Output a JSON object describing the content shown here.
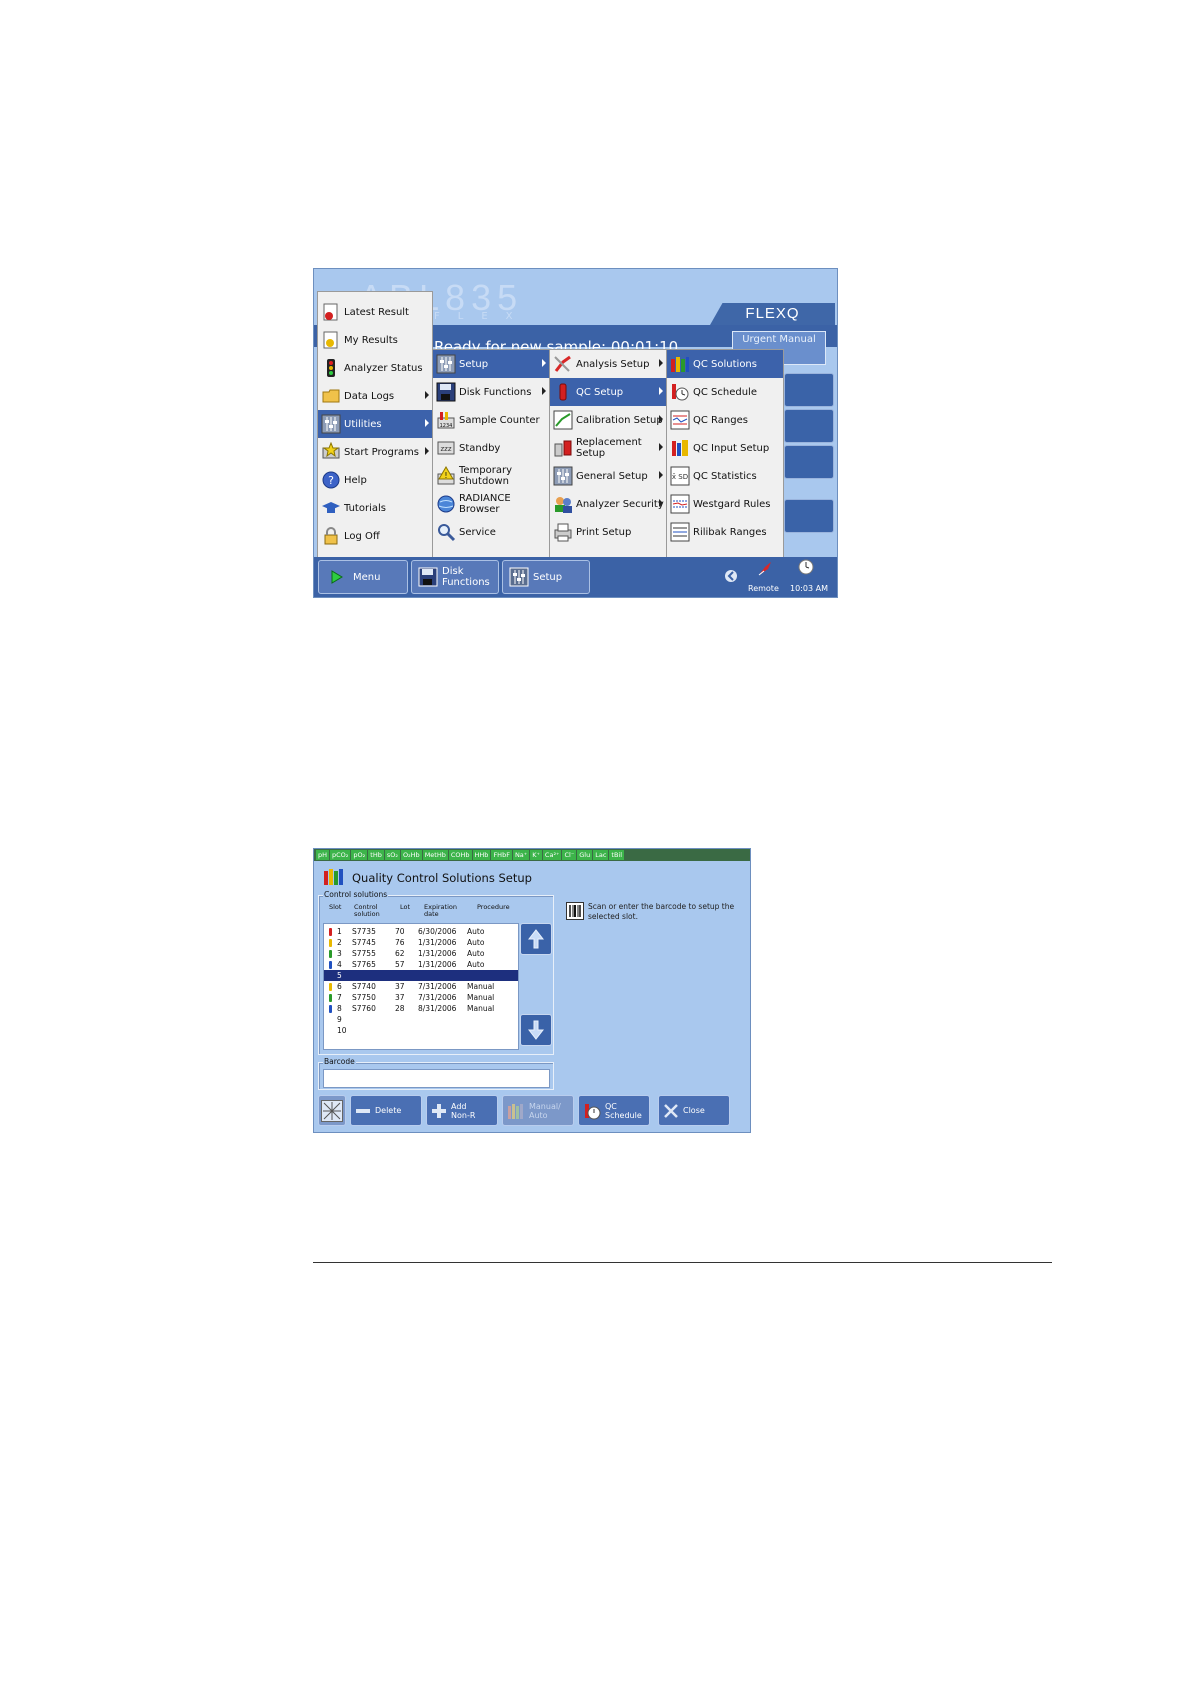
{
  "menu_screen": {
    "logo": "ABL835",
    "logo_sub": "FLEX",
    "model_badge": "FLEXQ",
    "status_text": "Ready for new sample: 00:01:10",
    "urgent_button": "Urgent Manual",
    "main_menu": [
      {
        "label": "Latest Result",
        "icon": "latest-result-icon"
      },
      {
        "label": "My Results",
        "icon": "my-results-icon"
      },
      {
        "label": "Analyzer Status",
        "icon": "traffic-light-icon"
      },
      {
        "label": "Data Logs",
        "icon": "folder-icon"
      },
      {
        "label": "Utilities",
        "icon": "sliders-icon"
      },
      {
        "label": "Start Programs",
        "icon": "star-programs-icon"
      },
      {
        "label": "Help",
        "icon": "help-icon"
      },
      {
        "label": "Tutorials",
        "icon": "tutorials-icon"
      },
      {
        "label": "Log Off",
        "icon": "lock-icon"
      }
    ],
    "utilities_menu": [
      {
        "label": "Setup",
        "icon": "sliders-icon"
      },
      {
        "label": "Disk Functions",
        "icon": "disk-icon"
      },
      {
        "label": "Sample Counter",
        "icon": "counter-icon"
      },
      {
        "label": "Standby",
        "icon": "standby-icon"
      },
      {
        "label": "Temporary\nShutdown",
        "icon": "warning-icon"
      },
      {
        "label": "RADIANCE\nBrowser",
        "icon": "globe-icon"
      },
      {
        "label": "Service",
        "icon": "magnifier-icon"
      }
    ],
    "setup_menu": [
      {
        "label": "Analysis Setup",
        "icon": "analysis-icon"
      },
      {
        "label": "QC Setup",
        "icon": "qc-bottle-icon"
      },
      {
        "label": "Calibration Setup",
        "icon": "calibration-icon"
      },
      {
        "label": "Replacement\nSetup",
        "icon": "replacement-icon"
      },
      {
        "label": "General Setup",
        "icon": "sliders-icon"
      },
      {
        "label": "Analyzer Security",
        "icon": "security-icon"
      },
      {
        "label": "Print Setup",
        "icon": "printer-icon"
      }
    ],
    "qc_setup_menu": [
      {
        "label": "QC Solutions",
        "icon": "qc-solutions-icon"
      },
      {
        "label": "QC Schedule",
        "icon": "qc-schedule-icon"
      },
      {
        "label": "QC Ranges",
        "icon": "qc-ranges-icon"
      },
      {
        "label": "QC Input Setup",
        "icon": "qc-input-icon"
      },
      {
        "label": "QC Statistics",
        "icon": "qc-statistics-icon"
      },
      {
        "label": "Westgard Rules",
        "icon": "westgard-icon"
      },
      {
        "label": "Rilibak Ranges",
        "icon": "rilibak-icon"
      }
    ],
    "taskbar": {
      "menu": "Menu",
      "disk": "Disk\nFunctions",
      "setup": "Setup",
      "remote": "Remote",
      "time": "10:03 AM"
    }
  },
  "qc_screen": {
    "params": [
      "pH",
      "pCO₂",
      "pO₂",
      "tHb",
      "sO₂",
      "O₂Hb",
      "MetHb",
      "COHb",
      "HHb",
      "FHbF",
      "Na⁺",
      "K⁺",
      "Ca²⁺",
      "Cl⁻",
      "Glu",
      "Lac",
      "tBil"
    ],
    "title": "Quality Control Solutions Setup",
    "group_label": "Control solutions",
    "columns": {
      "slot": "Slot",
      "control": "Control\nsolution",
      "lot": "Lot",
      "exp": "Expiration\ndate",
      "proc": "Procedure"
    },
    "rows": [
      {
        "slot": "1",
        "control": "S7735",
        "lot": "70",
        "exp": "6/30/2006",
        "proc": "Auto",
        "color": "#d32020"
      },
      {
        "slot": "2",
        "control": "S7745",
        "lot": "76",
        "exp": "1/31/2006",
        "proc": "Auto",
        "color": "#e8b800"
      },
      {
        "slot": "3",
        "control": "S7755",
        "lot": "62",
        "exp": "1/31/2006",
        "proc": "Auto",
        "color": "#2a9a2a"
      },
      {
        "slot": "4",
        "control": "S7765",
        "lot": "57",
        "exp": "1/31/2006",
        "proc": "Auto",
        "color": "#2050c0"
      },
      {
        "slot": "5",
        "control": "",
        "lot": "",
        "exp": "",
        "proc": "",
        "color": ""
      },
      {
        "slot": "6",
        "control": "S7740",
        "lot": "37",
        "exp": "7/31/2006",
        "proc": "Manual",
        "color": "#e8b800"
      },
      {
        "slot": "7",
        "control": "S7750",
        "lot": "37",
        "exp": "7/31/2006",
        "proc": "Manual",
        "color": "#2a9a2a"
      },
      {
        "slot": "8",
        "control": "S7760",
        "lot": "28",
        "exp": "8/31/2006",
        "proc": "Manual",
        "color": "#2050c0"
      },
      {
        "slot": "9",
        "control": "",
        "lot": "",
        "exp": "",
        "proc": "",
        "color": ""
      },
      {
        "slot": "10",
        "control": "",
        "lot": "",
        "exp": "",
        "proc": "",
        "color": ""
      }
    ],
    "selected_slot": "5",
    "hint": "Scan or enter the barcode to setup the selected slot.",
    "barcode_label": "Barcode",
    "barcode_value": "",
    "buttons": {
      "delete": "Delete",
      "add": "Add\nNon-R",
      "manual_auto": "Manual/\nAuto",
      "schedule": "QC\nSchedule",
      "close": "Close"
    }
  }
}
